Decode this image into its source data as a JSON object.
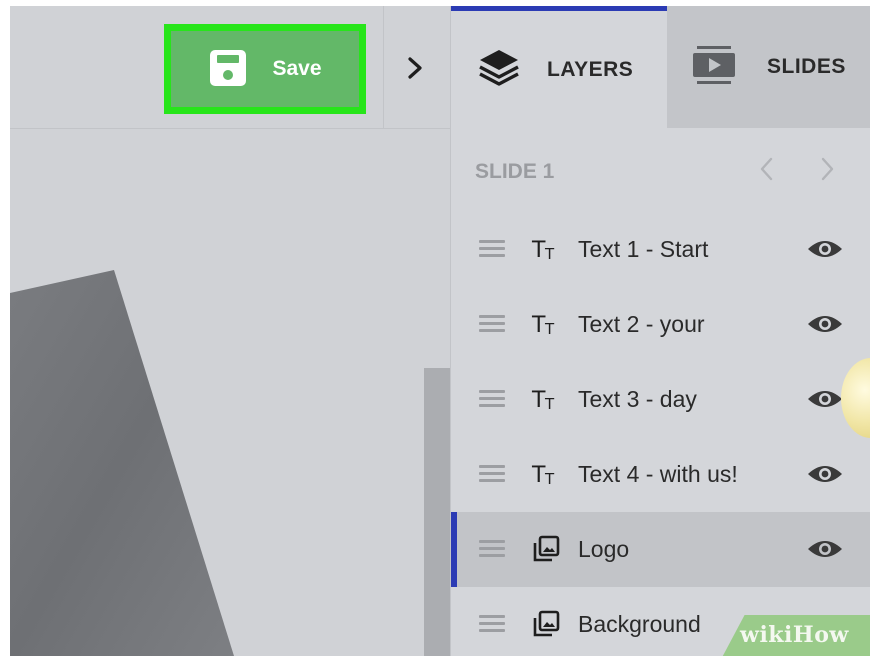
{
  "toolbar": {
    "save_label": "Save"
  },
  "panel": {
    "tabs": [
      {
        "label": "LAYERS",
        "icon": "layers-icon",
        "active": true
      },
      {
        "label": "SLIDES",
        "icon": "slides-icon",
        "active": false
      }
    ],
    "slide_title": "SLIDE 1",
    "layers": [
      {
        "name": "Text 1 - Start",
        "type": "text",
        "selected": false
      },
      {
        "name": "Text 2 - your",
        "type": "text",
        "selected": false
      },
      {
        "name": "Text 3 - day",
        "type": "text",
        "selected": false
      },
      {
        "name": "Text 4 - with us!",
        "type": "text",
        "selected": false
      },
      {
        "name": "Logo",
        "type": "image",
        "selected": true
      },
      {
        "name": "Background",
        "type": "image",
        "selected": false
      }
    ]
  },
  "watermark": {
    "part1": "wiki",
    "part2": "How"
  },
  "colors": {
    "save_highlight": "#27e51a",
    "save_button": "#63b868",
    "active_tab_accent": "#2b3bb4",
    "panel_background": "#d4d6da",
    "canvas_background": "#d0d2d6"
  }
}
